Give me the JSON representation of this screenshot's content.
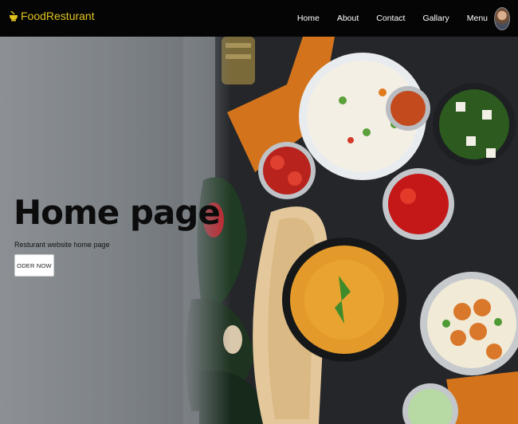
{
  "navbar": {
    "brand": "FoodResturant",
    "links": [
      "Home",
      "About",
      "Contact",
      "Gallary",
      "Menu"
    ]
  },
  "hero": {
    "title": "Home page",
    "subtitle": "Resturant website home page",
    "button_label": "ODER NOW"
  },
  "colors": {
    "navbar_bg": "#050505",
    "brand": "#e1c31d",
    "hero_bg": "#6f7479"
  },
  "icons": {
    "brand": "food-bowl-icon",
    "profile": "avatar"
  }
}
